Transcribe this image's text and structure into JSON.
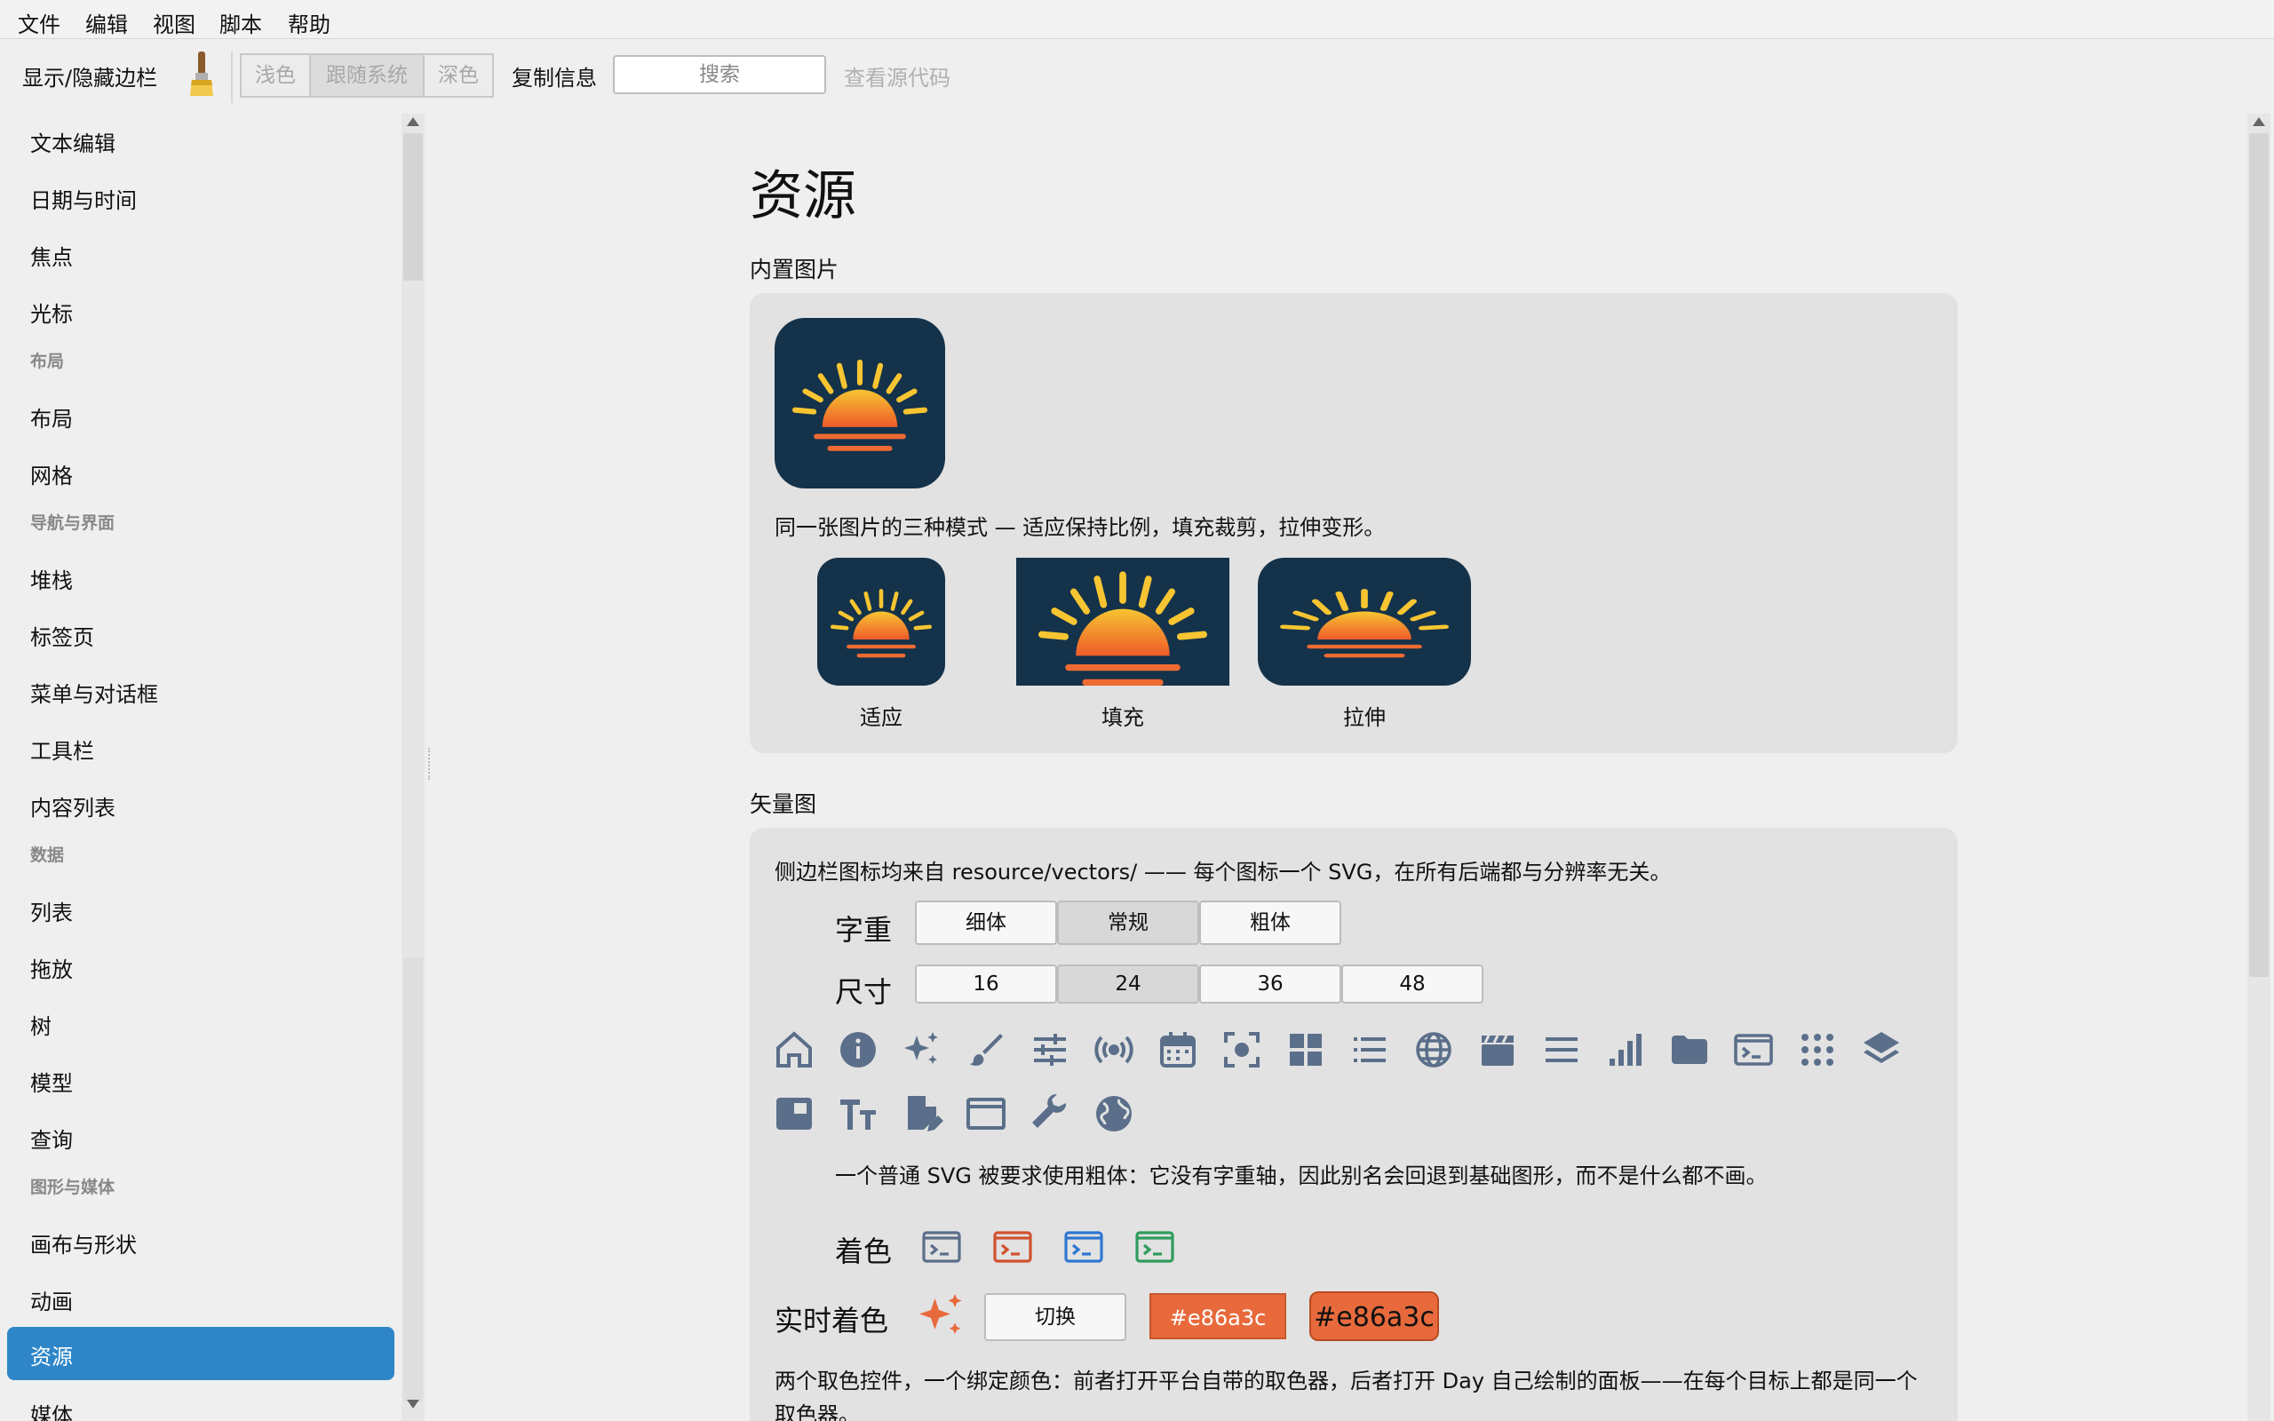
{
  "menu": [
    "文件",
    "编辑",
    "视图",
    "脚本",
    "帮助"
  ],
  "toolbar": {
    "toggle_sidebar": "显示/隐藏边栏",
    "brush_icon": "paint-brush-icon",
    "theme": {
      "light": "浅色",
      "system": "跟随系统",
      "dark": "深色",
      "selected": "跟随系统"
    },
    "copy_info": "复制信息",
    "search_placeholder": "搜索",
    "view_source": "查看源代码"
  },
  "sidebar": {
    "groups": [
      {
        "items": [
          "文本编辑",
          "日期与时间",
          "焦点",
          "光标"
        ]
      },
      {
        "header": "布局",
        "items": [
          "布局",
          "网格"
        ]
      },
      {
        "header": "导航与界面",
        "items": [
          "堆栈",
          "标签页",
          "菜单与对话框",
          "工具栏",
          "内容列表"
        ]
      },
      {
        "header": "数据",
        "items": [
          "列表",
          "拖放",
          "树",
          "模型",
          "查询"
        ]
      },
      {
        "header": "图形与媒体",
        "items": [
          "画布与形状",
          "动画",
          "资源",
          "媒体"
        ]
      }
    ],
    "selected": "资源"
  },
  "page": {
    "title": "资源",
    "builtin": {
      "title": "内置图片",
      "modes_caption": "同一张图片的三种模式 — 适应保持比例，填充裁剪，拉伸变形。",
      "modes": [
        "适应",
        "填充",
        "拉伸"
      ]
    },
    "vectors": {
      "title": "矢量图",
      "caption": "侧边栏图标均来自 resource/vectors/ —— 每个图标一个 SVG，在所有后端都与分辨率无关。",
      "weight_label": "字重",
      "weights": [
        "细体",
        "常规",
        "粗体"
      ],
      "weight_selected": "常规",
      "size_label": "尺寸",
      "sizes": [
        "16",
        "24",
        "36",
        "48"
      ],
      "size_selected": "24",
      "icons_row1": [
        "home-icon",
        "info-icon",
        "sparkles-icon",
        "brush-icon",
        "sliders-icon",
        "broadcast-icon",
        "calendar-icon",
        "focus-icon",
        "grid-icon",
        "list-icon",
        "globe-icon",
        "clapperboard-icon",
        "menu-icon",
        "bar-chart-icon",
        "folder-icon",
        "terminal-icon",
        "dots-grid-icon",
        "layers-icon"
      ],
      "icons_row2": [
        "dock-icon",
        "text-size-icon",
        "document-edit-icon",
        "window-icon",
        "wrench-icon",
        "earth-icon"
      ],
      "fallback_note": "一个普通 SVG 被要求使用粗体：它没有字重轴，因此别名会回退到基础图形，而不是什么都不画。",
      "tint_label": "着色",
      "tint_colors": [
        "#5b6f8a",
        "#d2522f",
        "#2f78d2",
        "#2f9c5c"
      ],
      "live_tint_label": "实时着色",
      "toggle_label": "切换",
      "color_hex": "#e86a3c",
      "color_picker_native": "#e86a3c",
      "color_picker_day": "#e86a3c",
      "picker_note": "两个取色控件，一个绑定颜色：前者打开平台自带的取色器，后者打开 Day 自己绘制的面板——在每个目标上都是同一个取色器。"
    }
  },
  "colors": {
    "accent": "#2e86c8",
    "icon": "#5b6f8a",
    "orange": "#e86a3c"
  }
}
